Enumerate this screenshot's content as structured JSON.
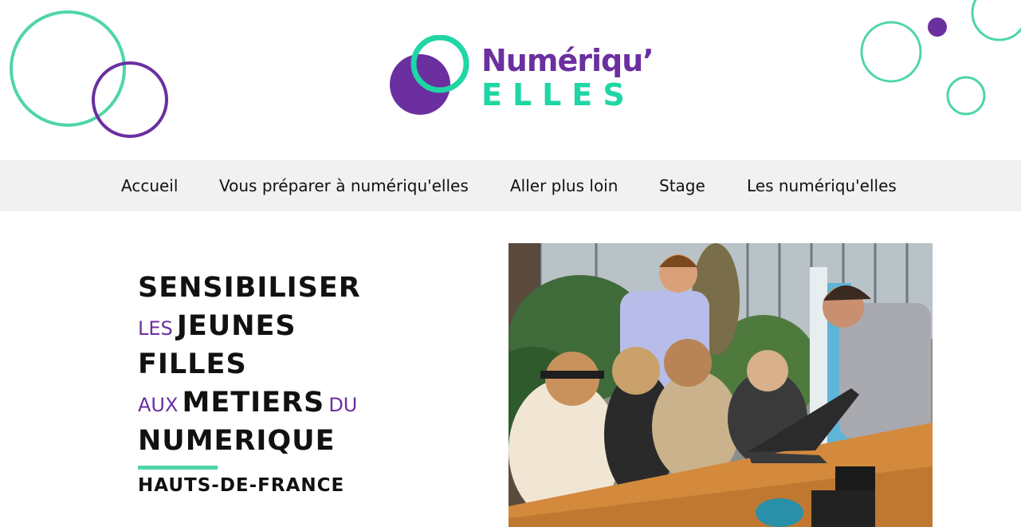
{
  "brand": {
    "logo_text_top": "Numériqu’",
    "logo_text_bottom": "ELLES",
    "colors": {
      "purple": "#6b2fa0",
      "green": "#1fd6a4",
      "circle_green": "#4fd5a9",
      "circle_purple": "#6b2fa0"
    }
  },
  "nav": {
    "items": [
      {
        "label": "Accueil"
      },
      {
        "label": "Vous préparer à numériqu'elles"
      },
      {
        "label": "Aller plus loin"
      },
      {
        "label": "Stage"
      },
      {
        "label": "Les numériqu'elles"
      }
    ]
  },
  "hero": {
    "line1_big": "SENSIBILISER",
    "line2_small": "LES",
    "line2_big": "JEUNES",
    "line3_big": "FILLES",
    "line4_small": "AUX",
    "line4_big": "METIERS",
    "line4_small2": "DU",
    "line5_big": "NUMERIQUE",
    "region": "HAUTS-DE-FRANCE"
  },
  "icons": [
    "decorative-circles-left",
    "decorative-circles-right",
    "logo-mark"
  ]
}
